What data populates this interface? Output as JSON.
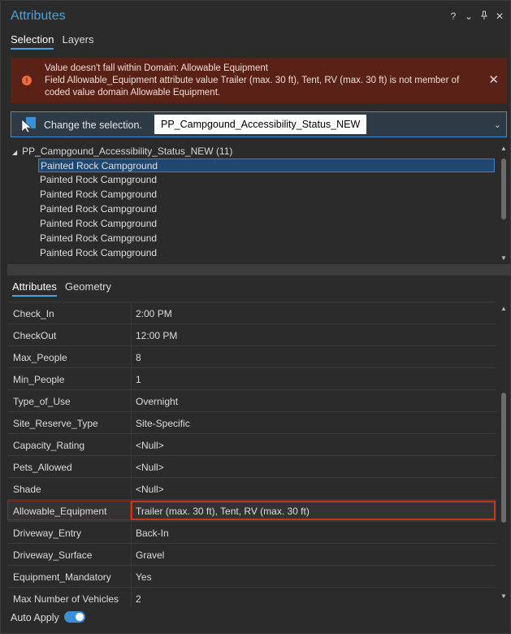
{
  "window": {
    "title": "Attributes",
    "controls": {
      "help": "?",
      "menu": "⌄",
      "pin": "⊥",
      "close": "✕"
    }
  },
  "top_tabs": [
    {
      "label": "Selection",
      "active": true
    },
    {
      "label": "Layers",
      "active": false
    }
  ],
  "error": {
    "line1": "Value doesn't fall within Domain: Allowable Equipment",
    "line2": "Field Allowable_Equipment attribute value Trailer (max. 30 ft), Tent, RV (max. 30 ft) is not member of coded value domain Allowable Equipment.",
    "icon": "error-icon",
    "close": "✕",
    "color": "#5a2217"
  },
  "selection": {
    "label": "Change the selection.",
    "value": "PP_Campgound_Accessibility_Status_NEW",
    "chevron": "⌄"
  },
  "tree": {
    "layer": "PP_Campgound_Accessibility_Status_NEW (11)",
    "items": [
      "Painted Rock Campground",
      "Painted Rock Campground",
      "Painted Rock Campground",
      "Painted Rock Campground",
      "Painted Rock Campground",
      "Painted Rock Campground",
      "Painted Rock Campground"
    ]
  },
  "attr_tabs": [
    {
      "label": "Attributes",
      "active": true
    },
    {
      "label": "Geometry",
      "active": false
    }
  ],
  "attributes": [
    {
      "name": "Check_In",
      "value": "2:00 PM"
    },
    {
      "name": "CheckOut",
      "value": "12:00 PM"
    },
    {
      "name": "Max_People",
      "value": "8"
    },
    {
      "name": "Min_People",
      "value": "1"
    },
    {
      "name": "Type_of_Use",
      "value": "Overnight"
    },
    {
      "name": "Site_Reserve_Type",
      "value": "Site-Specific"
    },
    {
      "name": "Capacity_Rating",
      "value": "<Null>"
    },
    {
      "name": "Pets_Allowed",
      "value": "<Null>"
    },
    {
      "name": "Shade",
      "value": "<Null>"
    },
    {
      "name": "Allowable_Equipment",
      "value": "Trailer (max. 30 ft), Tent, RV (max. 30 ft)",
      "error": true
    },
    {
      "name": "Driveway_Entry",
      "value": "Back-In"
    },
    {
      "name": "Driveway_Surface",
      "value": "Gravel"
    },
    {
      "name": "Equipment_Mandatory",
      "value": "Yes"
    },
    {
      "name": "Max Number of Vehicles",
      "value": "2"
    }
  ],
  "auto_apply": {
    "label": "Auto Apply",
    "enabled": true
  },
  "colors": {
    "accent": "#4aa3e0",
    "error_border": "#c2391c"
  }
}
